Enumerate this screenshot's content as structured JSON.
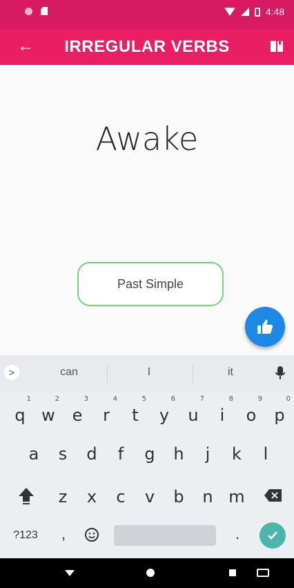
{
  "status_bar": {
    "time": "4:48"
  },
  "app_bar": {
    "title": "IRREGULAR VERBS",
    "back_icon": "arrow-left-icon",
    "right_icon": "book-icon"
  },
  "content": {
    "verb": "Awake",
    "answer_placeholder": "Past Simple"
  },
  "fab": {
    "icon": "thumbs-up-icon",
    "color": "#1e88e5"
  },
  "keyboard": {
    "suggestions": [
      "can",
      "I",
      "it"
    ],
    "row1": [
      {
        "k": "q",
        "n": "1"
      },
      {
        "k": "w",
        "n": "2"
      },
      {
        "k": "e",
        "n": "3"
      },
      {
        "k": "r",
        "n": "4"
      },
      {
        "k": "t",
        "n": "5"
      },
      {
        "k": "y",
        "n": "6"
      },
      {
        "k": "u",
        "n": "7"
      },
      {
        "k": "i",
        "n": "8"
      },
      {
        "k": "o",
        "n": "9"
      },
      {
        "k": "p",
        "n": "0"
      }
    ],
    "row2": [
      "a",
      "s",
      "d",
      "f",
      "g",
      "h",
      "j",
      "k",
      "l"
    ],
    "row3": [
      "z",
      "x",
      "c",
      "v",
      "b",
      "n",
      "m"
    ],
    "symbols_label": "?123",
    "comma": ",",
    "period": "."
  },
  "colors": {
    "status_bar": "#d81b60",
    "app_bar": "#e91e63",
    "answer_border": "#6fd57e",
    "enter_key": "#4db6ac"
  }
}
